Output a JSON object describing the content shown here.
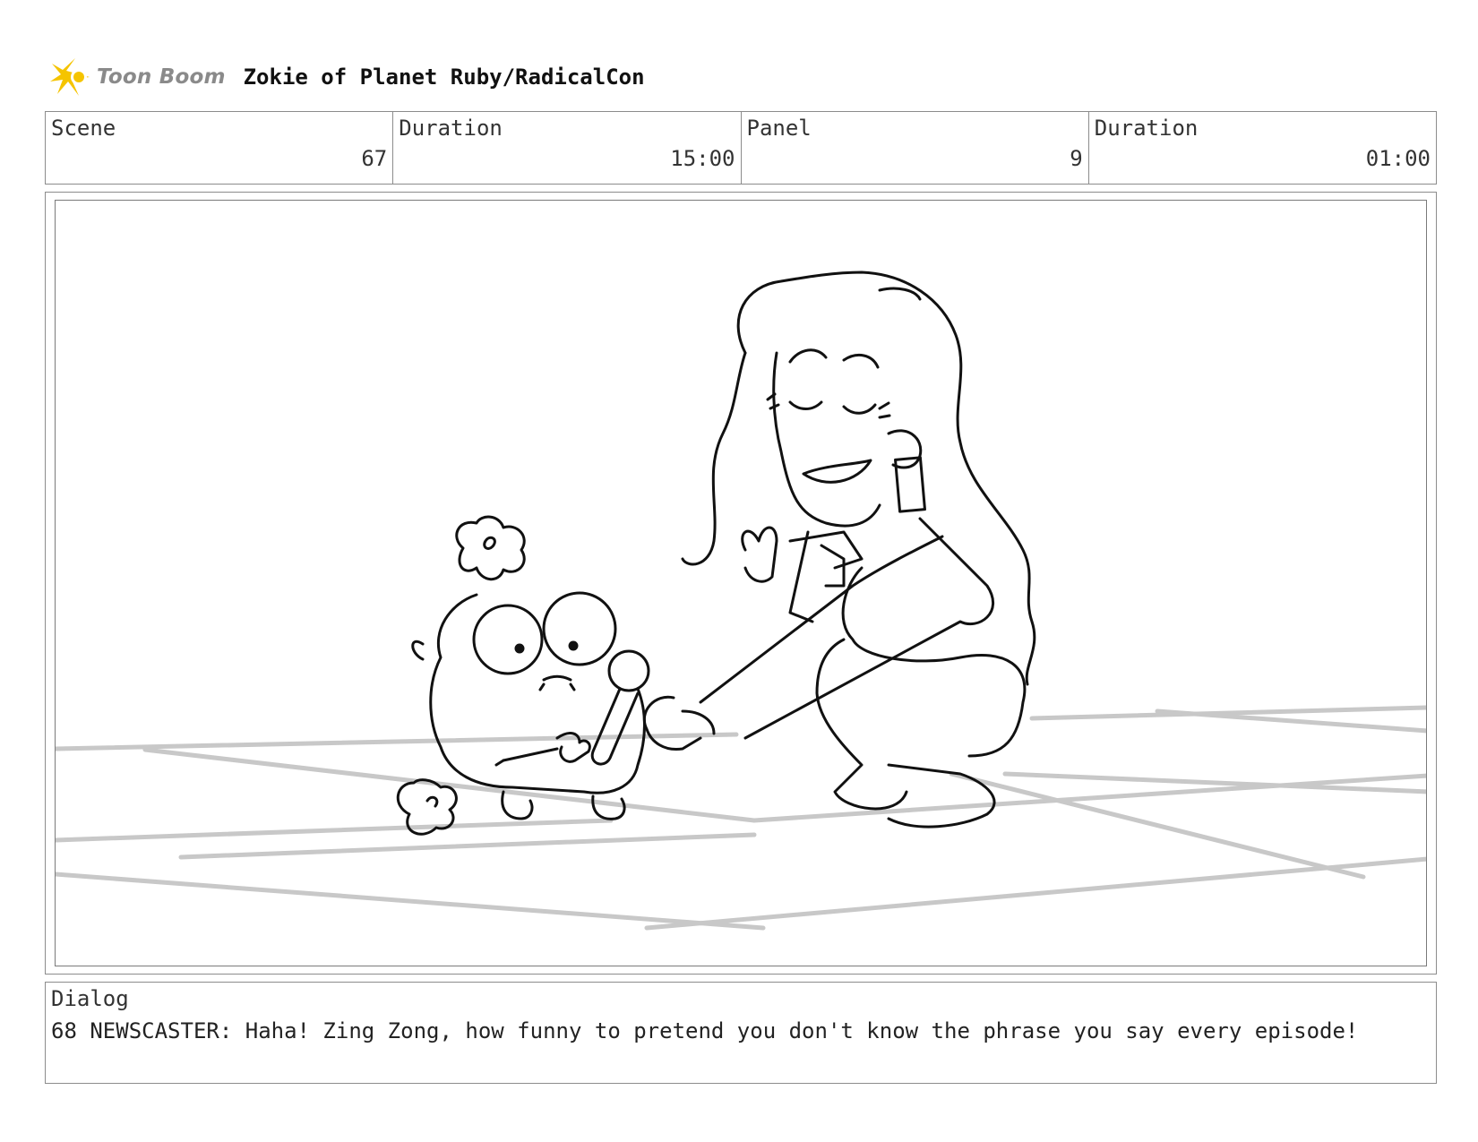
{
  "header": {
    "logo_text": "Toon Boom",
    "project_title": "Zokie of Planet Ruby/RadicalCon"
  },
  "info": [
    {
      "label": "Scene",
      "value": "67"
    },
    {
      "label": "Duration",
      "value": "15:00"
    },
    {
      "label": "Panel",
      "value": "9"
    },
    {
      "label": "Duration",
      "value": "01:00"
    }
  ],
  "panel": {
    "icon": "storyboard-sketch",
    "content": "sketch of woman with long hair crouching and holding a microphone to a small round creature on a tiled floor"
  },
  "dialog": {
    "label": "Dialog",
    "text": "68 NEWSCASTER: Haha! Zing Zong, how funny to pretend you don't know the phrase you say every episode!"
  },
  "colors": {
    "border": "#8c8c8c",
    "logo_yellow": "#f5c400",
    "logo_text": "#8a8a8a",
    "floor_lines": "#c8c8c8"
  }
}
